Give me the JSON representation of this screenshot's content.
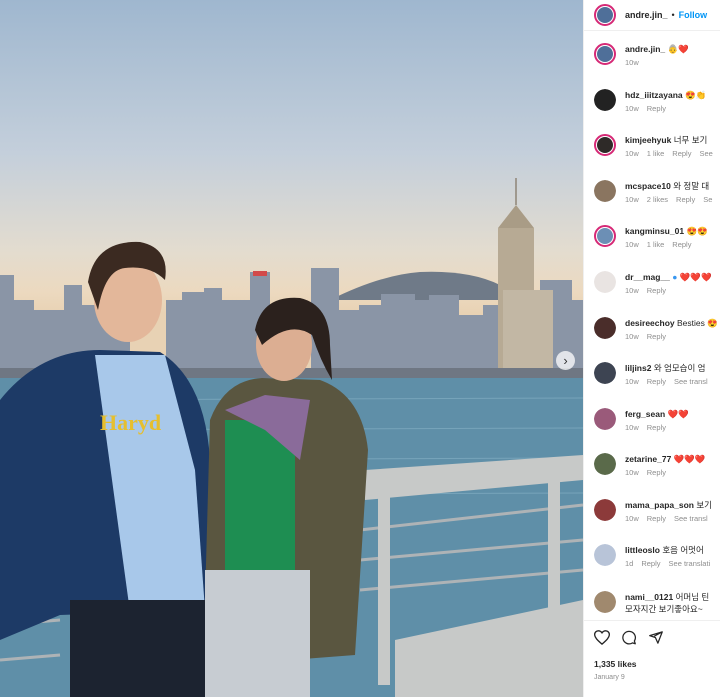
{
  "post": {
    "author": "andre.jin_",
    "follow_label": "Follow",
    "dot": "•",
    "caption_user": "andre.jin_",
    "caption_text": "👵❤️",
    "caption_time": "10w",
    "likes": "1,335 likes",
    "date": "January 9"
  },
  "comments": [
    {
      "user": "hdz_iiitzayana",
      "text": "😍👏",
      "time": "10w",
      "likes": "",
      "reply": "Reply",
      "extra": ""
    },
    {
      "user": "kimjeehyuk",
      "text": "너무 보기",
      "time": "10w",
      "likes": "1 like",
      "reply": "Reply",
      "extra": "See"
    },
    {
      "user": "mcspace10",
      "text": "와 정말 대",
      "time": "10w",
      "likes": "2 likes",
      "reply": "Reply",
      "extra": "Se"
    },
    {
      "user": "kangminsu_01",
      "text": "😍😍",
      "time": "10w",
      "likes": "1 like",
      "reply": "Reply",
      "extra": ""
    },
    {
      "user": "dr__mag__",
      "text": "❤️❤️❤️",
      "time": "10w",
      "likes": "",
      "reply": "Reply",
      "extra": ""
    },
    {
      "user": "desireechoy",
      "text": "Besties 😍",
      "time": "10w",
      "likes": "",
      "reply": "Reply",
      "extra": ""
    },
    {
      "user": "liljins2",
      "text": "와 엄모습이 엄",
      "time": "10w",
      "likes": "",
      "reply": "Reply",
      "extra": "See transl"
    },
    {
      "user": "ferg_sean",
      "text": "❤️❤️",
      "time": "10w",
      "likes": "",
      "reply": "Reply",
      "extra": ""
    },
    {
      "user": "zetarine_77",
      "text": "❤️❤️❤️",
      "time": "10w",
      "likes": "",
      "reply": "Reply",
      "extra": ""
    },
    {
      "user": "mama_papa_son",
      "text": "보기",
      "time": "10w",
      "likes": "",
      "reply": "Reply",
      "extra": "See transl"
    },
    {
      "user": "littleoslo",
      "text": "호음 어멋어",
      "time": "1d",
      "likes": "",
      "reply": "Reply",
      "extra": "See translati"
    },
    {
      "user": "nami__0121",
      "text": "어머님 틴",
      "time": "",
      "likes": "",
      "reply": "",
      "extra": "",
      "line2": "모자지간 보기좋아요~"
    }
  ],
  "icons": [
    "heart-icon",
    "comment-icon",
    "share-icon"
  ],
  "photo": {
    "next_arrow": "›"
  }
}
